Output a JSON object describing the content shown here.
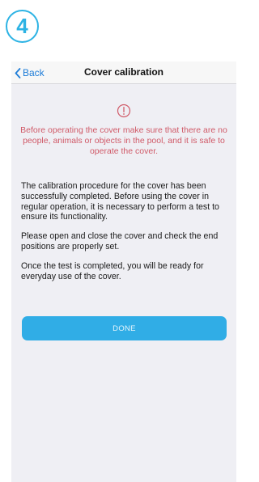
{
  "step": {
    "number": "4",
    "color": "#2db3e4"
  },
  "navbar": {
    "back_label": "Back",
    "back_icon": "chevron-left-icon",
    "title": "Cover calibration"
  },
  "warning": {
    "icon": "exclamation-circle-icon",
    "color": "#d05a68",
    "text": "Before operating the cover make sure that there are no people, animals or objects in the pool, and it is safe to operate the cover."
  },
  "content": {
    "paragraphs": [
      "The calibration procedure for the cover has been successfully completed. Before using the cover in regular operation, it is necessary to perform a test to ensure its functionality.",
      "Please open and close the cover and check the end positions are properly set.",
      "Once the test is completed, you will be ready for everyday use of the cover."
    ]
  },
  "done_button": {
    "label": "DONE",
    "color": "#30ade6"
  }
}
